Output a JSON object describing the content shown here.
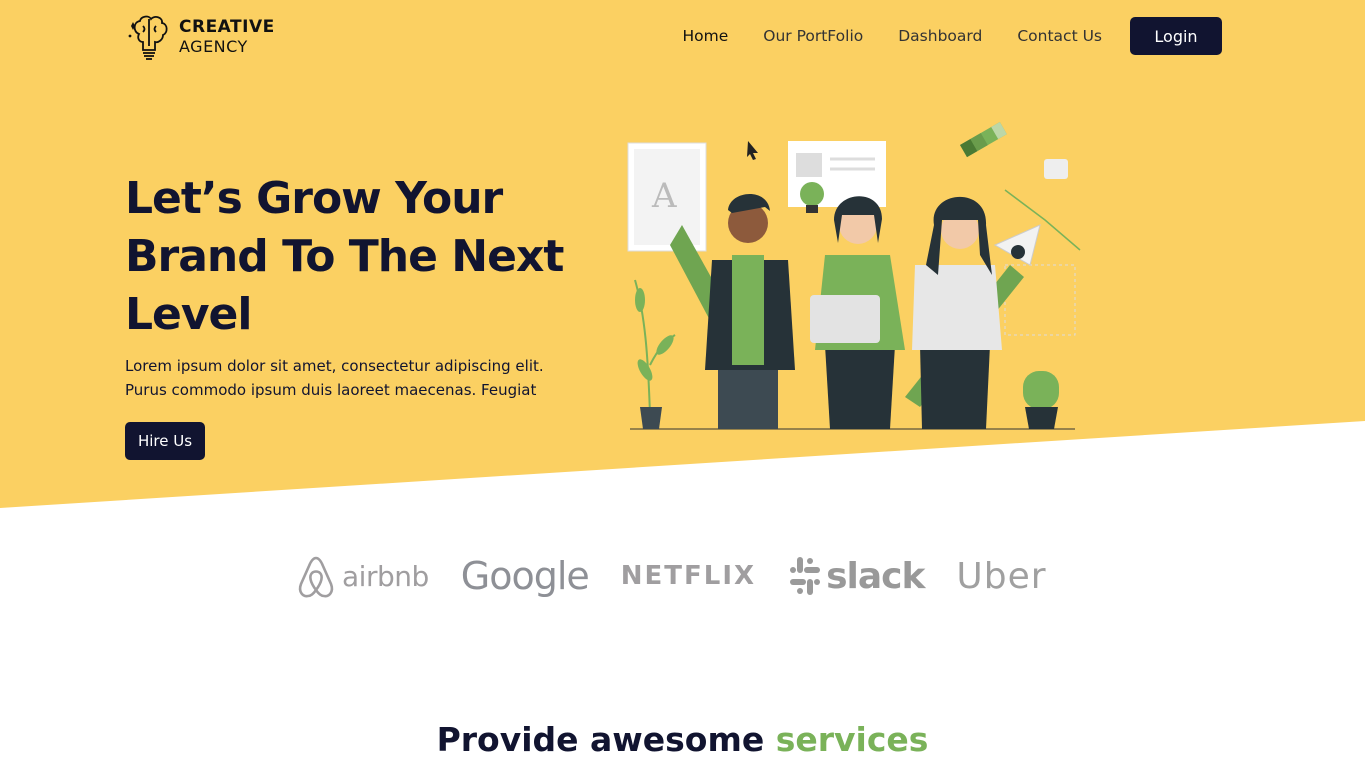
{
  "header": {
    "logo_line1": "CREATIVE",
    "logo_line2": "AGENCY",
    "nav": [
      {
        "label": "Home"
      },
      {
        "label": "Our PortFolio"
      },
      {
        "label": "Dashboard"
      },
      {
        "label": "Contact Us"
      }
    ],
    "login_label": "Login"
  },
  "hero": {
    "title": "Let’s Grow Your Brand To The Next Level",
    "description": "Lorem ipsum dolor sit amet, consectetur adipiscing elit. Purus commodo ipsum duis laoreet maecenas. Feugiat",
    "cta_label": "Hire Us",
    "illustration_letter": "A"
  },
  "brands": [
    {
      "name": "airbnb",
      "icon": "airbnb-logo-icon"
    },
    {
      "name": "Google",
      "icon": null
    },
    {
      "name": "NETFLIX",
      "icon": null
    },
    {
      "name": "slack",
      "icon": "slack-logo-icon"
    },
    {
      "name": "Uber",
      "icon": null
    }
  ],
  "services": {
    "title_main": "Provide awesome ",
    "title_accent": "services"
  },
  "colors": {
    "hero_bg": "#fbd062",
    "dark": "#111430",
    "accent_green": "#7ab259"
  }
}
